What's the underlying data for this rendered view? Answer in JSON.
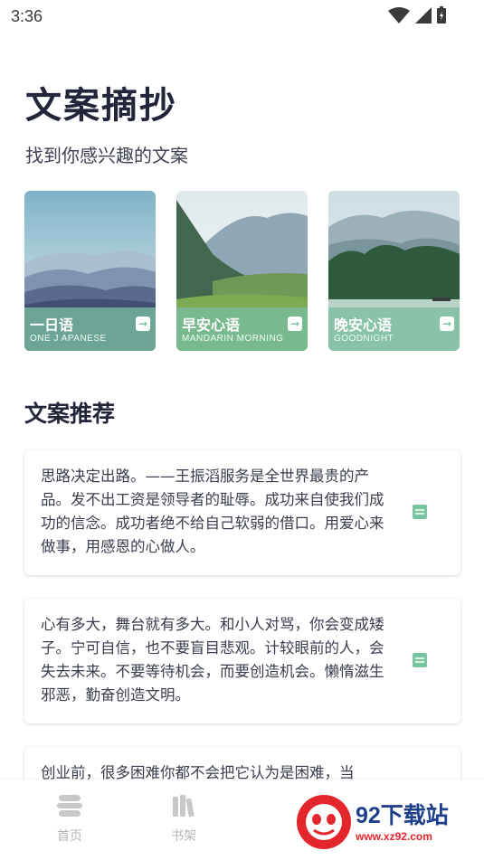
{
  "status_bar": {
    "time": "3:36",
    "icons": [
      "wifi-icon",
      "cellular-signal-icon",
      "battery-icon"
    ]
  },
  "header": {
    "title": "文案摘抄",
    "subtitle": "找到你感兴趣的文案"
  },
  "categories": [
    {
      "title": "一日语",
      "subtitle": "ONE J APANESE",
      "icon": "arrow-right-icon"
    },
    {
      "title": "早安心语",
      "subtitle": "MANDARIN MORNING",
      "icon": "arrow-right-icon"
    },
    {
      "title": "晚安心语",
      "subtitle": "GOODNIGHT",
      "icon": "arrow-right-icon"
    }
  ],
  "recommend": {
    "title": "文案推荐",
    "items": [
      {
        "text": "思路决定出路。——王振滔服务是全世界最贵的产品。发不出工资是领导者的耻辱。成功来自使我们成功的信念。成功者绝不给自己软弱的借口。用爱心来做事，用感恩的心做人。",
        "icon": "note-icon"
      },
      {
        "text": "心有多大，舞台就有多大。和小人对骂，你会变成矮子。宁可自信，也不要盲目悲观。计较眼前的人，会失去未来。不要等待机会，而要创造机会。懒惰滋生邪恶，勤奋创造文明。",
        "icon": "note-icon"
      },
      {
        "text": "创业前，很多困难你都不会把它认为是困难，当",
        "icon": "note-icon"
      }
    ]
  },
  "bottom_nav": [
    {
      "label": "首页",
      "icon": "home-icon"
    },
    {
      "label": "书架",
      "icon": "bookshelf-icon"
    }
  ],
  "watermark": {
    "brand": "92下载站",
    "url": "www.xz92.com"
  },
  "colors": {
    "accent": "#7cc4a2",
    "title": "#23263a",
    "nav_inactive": "#b5b5b5",
    "watermark_blue": "#1e3f8c",
    "watermark_red": "#e2262b"
  }
}
